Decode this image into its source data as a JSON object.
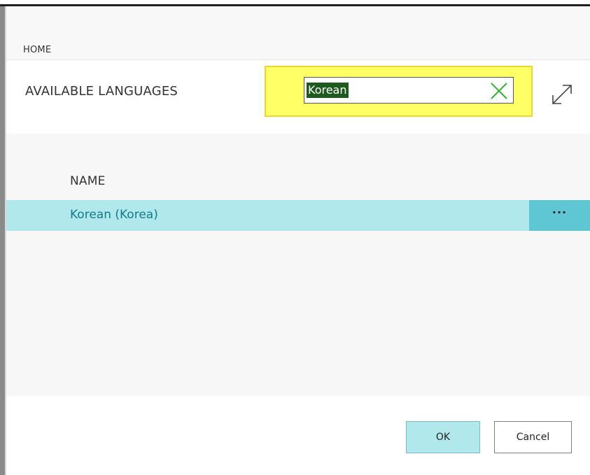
{
  "ribbon": {
    "tabs": [
      {
        "label": "HOME"
      }
    ]
  },
  "page": {
    "title": "AVAILABLE LANGUAGES"
  },
  "search": {
    "value": "Korean"
  },
  "list": {
    "columns": [
      {
        "label": "NAME"
      }
    ],
    "rows": [
      {
        "name": "Korean (Korea)",
        "selected": true
      }
    ],
    "row_actions_label": "···"
  },
  "footer": {
    "ok_label": "OK",
    "cancel_label": "Cancel"
  },
  "colors": {
    "highlight": "#ffff66",
    "selected_row": "#b0e8ec",
    "row_action": "#5fc7d3",
    "link": "#107c8c",
    "clear_icon": "#2db52d"
  },
  "icons": {
    "clear": "close-icon",
    "expand": "expand-icon"
  }
}
